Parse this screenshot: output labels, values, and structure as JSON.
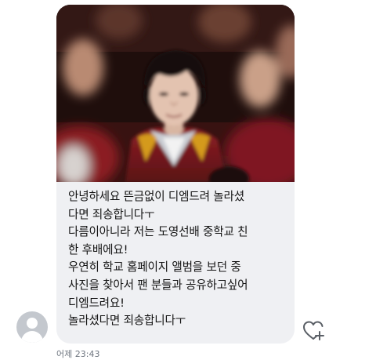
{
  "conversation": {
    "sender_avatar": "default-avatar-icon",
    "message": {
      "photo_description": "graduation-photo",
      "text": "안녕하세요 뜬금없이 디엠드려 놀라셨\n다면 죄송합니다ㅜ\n다름이아니라 저는 도영선배 중학교 친\n한 후배에요!\n우연히 학교 홈페이지 앨범을 보던 중\n사진을 찾아서 팬 분들과 공유하고싶어\n디엠드려요!\n놀라셨다면 죄송합니다ㅜ",
      "timestamp": "어제 23:43"
    },
    "like_icon": "heart-plus-icon",
    "colors": {
      "bubble": "#eff0f3",
      "text": "#141414",
      "timestamp": "#6f7680",
      "avatar": "#c4c8ce"
    }
  }
}
